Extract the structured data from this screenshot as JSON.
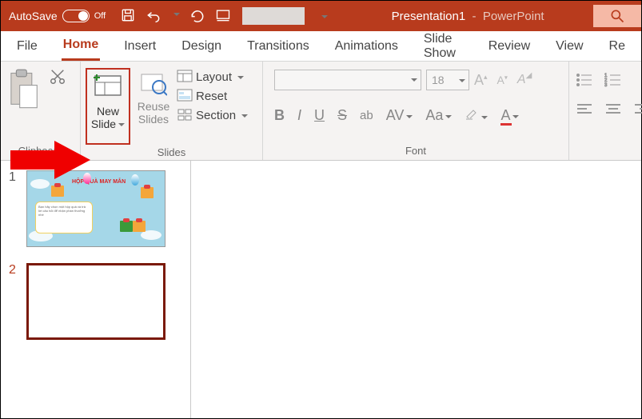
{
  "titlebar": {
    "autosave_label": "AutoSave",
    "autosave_state": "Off",
    "title_doc": "Presentation1",
    "title_app": "PowerPoint"
  },
  "tabs": {
    "file": "File",
    "home": "Home",
    "insert": "Insert",
    "design": "Design",
    "transitions": "Transitions",
    "animations": "Animations",
    "slideshow": "Slide Show",
    "review": "Review",
    "view": "View",
    "record": "Re"
  },
  "ribbon": {
    "clipboard": {
      "label": "Clipboard"
    },
    "slides": {
      "label": "Slides",
      "newslide_l1": "New",
      "newslide_l2": "Slide",
      "reuse_l1": "Reuse",
      "reuse_l2": "Slides",
      "layout": "Layout",
      "reset": "Reset",
      "section": "Section"
    },
    "font": {
      "label": "Font",
      "size_value": "18"
    }
  },
  "slidepanel": {
    "s1_num": "1",
    "s2_num": "2",
    "s1_title": "HỘP QUÀ MAY MẮN"
  }
}
